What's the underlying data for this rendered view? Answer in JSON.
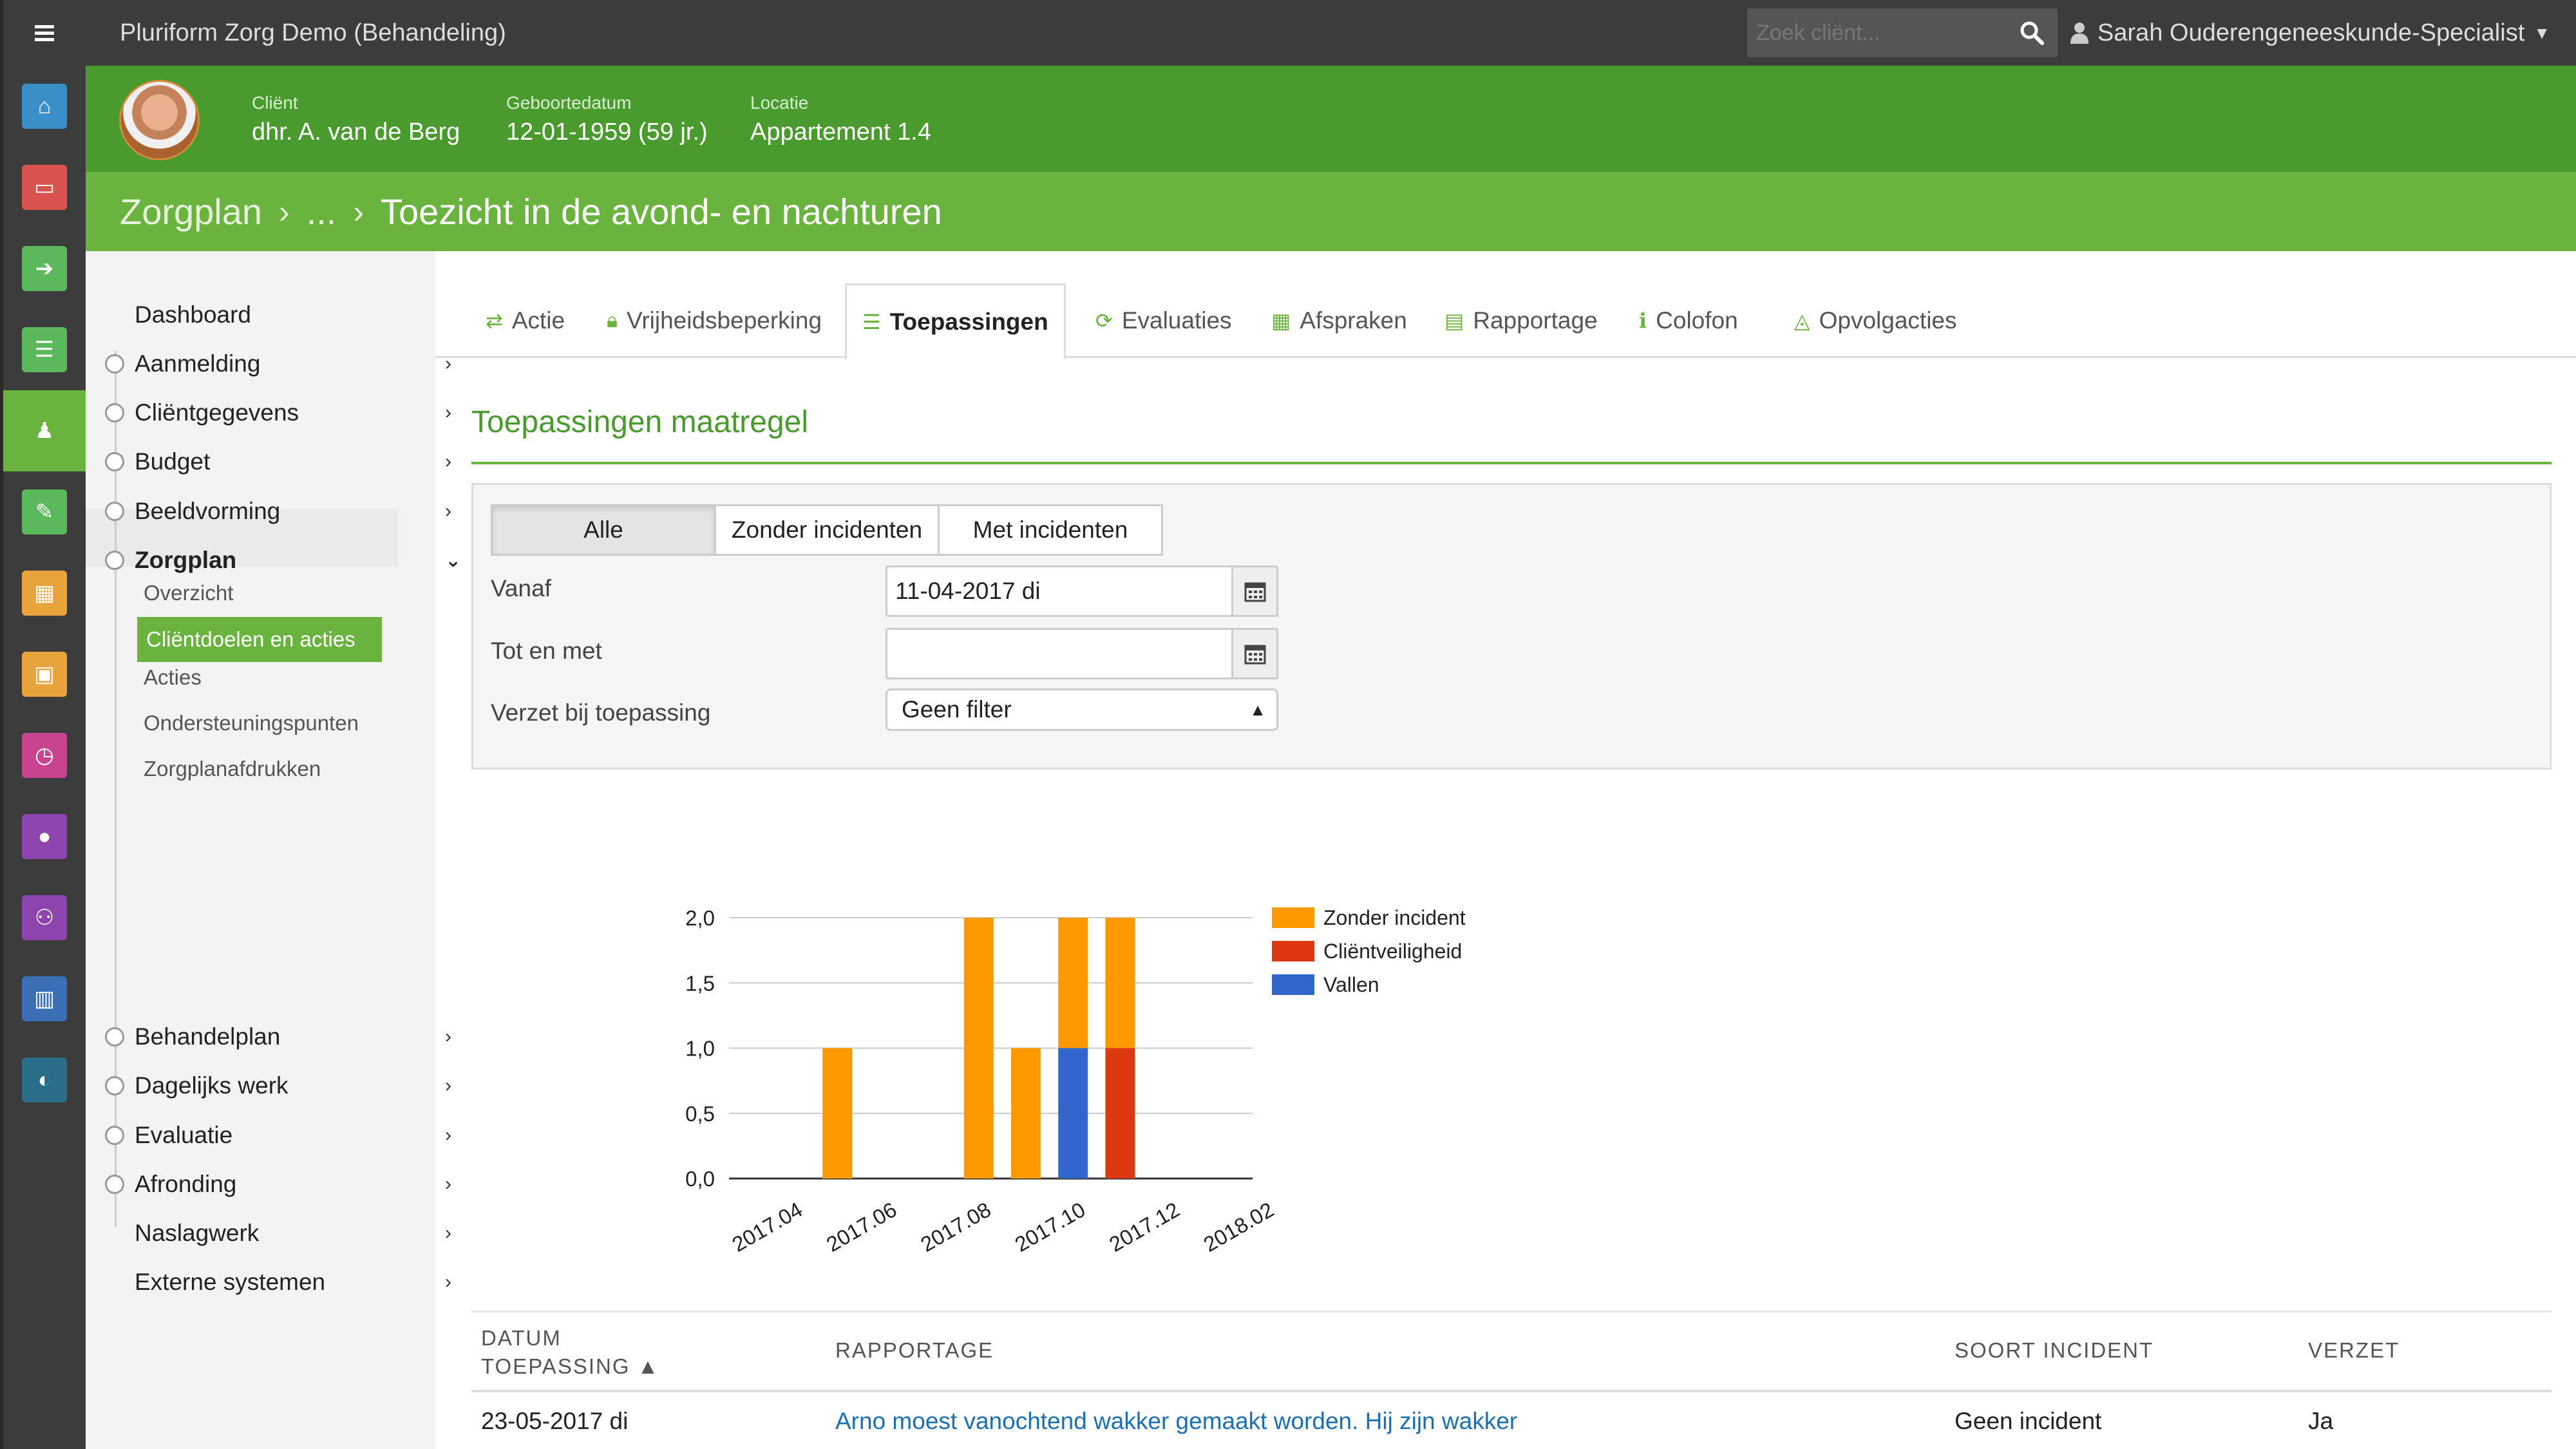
{
  "app": {
    "title": "Pluriform Zorg Demo  (Behandeling)",
    "search_placeholder": "Zoek cliënt...",
    "user": "Sarah Ouderengeneeskunde-Specialist"
  },
  "client": {
    "client_label": "Cliënt",
    "client_name": "dhr. A. van de Berg",
    "dob_label": "Geboortedatum",
    "dob_value": "12-01-1959 (59 jr.)",
    "location_label": "Locatie",
    "location_value": "Appartement 1.4"
  },
  "breadcrumb": {
    "root": "Zorgplan",
    "ellipsis": "...",
    "current": "Toezicht in de avond- en nachturen"
  },
  "rail": {
    "icons": [
      "home-icon",
      "inbox-icon",
      "sign-in-icon",
      "list-icon",
      "person-icon",
      "pencil-icon",
      "calendar-icon",
      "calendar-alt-icon",
      "clock-icon",
      "user-icon",
      "users-icon",
      "bar-chart-icon",
      "dashboard-icon"
    ],
    "colors": [
      "#3a8fc9",
      "#d9534f",
      "#5cb85c",
      "#5cb85c",
      "#6bb33f",
      "#5cb85c",
      "#e8a33c",
      "#e8a33c",
      "#c9448e",
      "#8e44ad",
      "#8e44ad",
      "#3a6fb5",
      "#2c6e8a"
    ]
  },
  "nav": {
    "items": [
      {
        "label": "Dashboard",
        "has_children": false
      },
      {
        "label": "Aanmelding",
        "has_children": true
      },
      {
        "label": "Cliëntgegevens",
        "has_children": true
      },
      {
        "label": "Budget",
        "has_children": true
      },
      {
        "label": "Beeldvorming",
        "has_children": true
      },
      {
        "label": "Zorgplan",
        "has_children": true,
        "expanded": true
      },
      {
        "label": "Behandelplan",
        "has_children": true
      },
      {
        "label": "Dagelijks werk",
        "has_children": true
      },
      {
        "label": "Evaluatie",
        "has_children": true
      },
      {
        "label": "Afronding",
        "has_children": true
      },
      {
        "label": "Naslagwerk",
        "has_children": true
      },
      {
        "label": "Externe systemen",
        "has_children": true
      }
    ],
    "zorgplan_children": [
      "Overzicht",
      "Cliëntdoelen en acties",
      "Acties",
      "Ondersteuningspunten",
      "Zorgplanafdrukken"
    ],
    "active_child": "Cliëntdoelen en acties"
  },
  "tabs": [
    {
      "label": "Actie",
      "icon": "shuffle-icon"
    },
    {
      "label": "Vrijheidsbeperking",
      "icon": "lock-icon"
    },
    {
      "label": "Toepassingen",
      "icon": "list-icon",
      "active": true
    },
    {
      "label": "Evaluaties",
      "icon": "refresh-icon"
    },
    {
      "label": "Afspraken",
      "icon": "calendar-icon"
    },
    {
      "label": "Rapportage",
      "icon": "document-icon"
    },
    {
      "label": "Colofon",
      "icon": "info-icon"
    },
    {
      "label": "Opvolgacties",
      "icon": "bell-icon"
    }
  ],
  "section": {
    "title": "Toepassingen maatregel"
  },
  "filter": {
    "segments": [
      "Alle",
      "Zonder incidenten",
      "Met incidenten"
    ],
    "active_segment": "Alle",
    "from_label": "Vanaf",
    "from_value": "11-04-2017 di",
    "to_label": "Tot en met",
    "to_value": "",
    "verzet_label": "Verzet bij toepassing",
    "verzet_value": "Geen filter"
  },
  "chart_data": {
    "type": "bar",
    "stacked": true,
    "x_ticks": [
      "2017.04",
      "2017.06",
      "2017.08",
      "2017.10",
      "2017.12",
      "2018.02"
    ],
    "y_ticks": [
      "0,0",
      "0,5",
      "1,0",
      "1,5",
      "2,0"
    ],
    "ylim": [
      0,
      2
    ],
    "categories": [
      "2017.05",
      "2017.08",
      "2017.09",
      "2017.10",
      "2017.11"
    ],
    "series": [
      {
        "name": "Zonder incident",
        "color": "#ff9900",
        "values": [
          1,
          2,
          1,
          1,
          1
        ]
      },
      {
        "name": "Cliëntveiligheid",
        "color": "#dc3912",
        "values": [
          0,
          0,
          0,
          0,
          1
        ]
      },
      {
        "name": "Vallen",
        "color": "#3366cc",
        "values": [
          0,
          0,
          0,
          1,
          0
        ]
      }
    ],
    "grid": true,
    "legend": "right"
  },
  "table": {
    "headers": [
      "DATUM TOEPASSING ▲",
      "RAPPORTAGE",
      "SOORT INCIDENT",
      "VERZET"
    ],
    "rows": [
      {
        "datum": "23-05-2017 di",
        "rapportage": "Arno moest vanochtend wakker gemaakt worden. Hij zijn wakker",
        "soort": "Geen incident",
        "verzet": "Ja"
      }
    ]
  }
}
